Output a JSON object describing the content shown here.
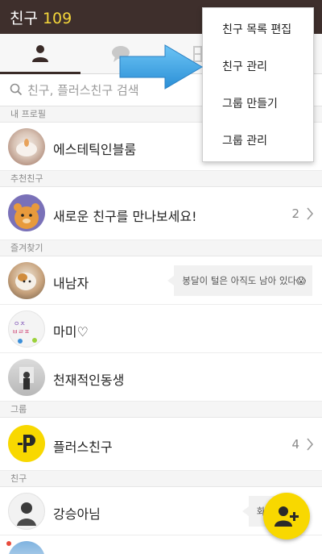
{
  "header": {
    "title": "친구",
    "count": "109"
  },
  "tabs": [
    {
      "name": "friends",
      "icon": "person-icon",
      "active": true
    },
    {
      "name": "chats",
      "icon": "chat-bubble-icon",
      "active": false
    },
    {
      "name": "channels",
      "icon": "grid-icon",
      "active": false
    }
  ],
  "search": {
    "placeholder": "친구, 플러스친구 검색"
  },
  "sections": {
    "my_profile": "내 프로필",
    "recommended": "추천친구",
    "favorites": "즐겨찾기",
    "groups": "그룹",
    "friends": "친구"
  },
  "my_profile": {
    "name": "에스테틱인블룸"
  },
  "recommended": {
    "name": "새로운 친구를 만나보세요!",
    "count": "2"
  },
  "favorites": [
    {
      "name": "내남자",
      "status": "봉달이 털은 아직도 남아 있다😱"
    },
    {
      "name": "마미♡",
      "status": ""
    },
    {
      "name": "천재적인동생",
      "status": ""
    }
  ],
  "groups": [
    {
      "name": "플러스친구",
      "count": "4"
    }
  ],
  "friends": [
    {
      "name": "강승아님",
      "status": "화이"
    }
  ],
  "menu": {
    "items": [
      "친구 목록 편집",
      "친구 관리",
      "그룹 만들기",
      "그룹 관리"
    ]
  },
  "colors": {
    "header_bg": "#3e2f2c",
    "count": "#f4d63a",
    "fab": "#f8d800",
    "arrow": "#3aa7e8",
    "badge_dot": "#e84b3c"
  },
  "fab": {
    "icon": "add-friend-icon"
  }
}
